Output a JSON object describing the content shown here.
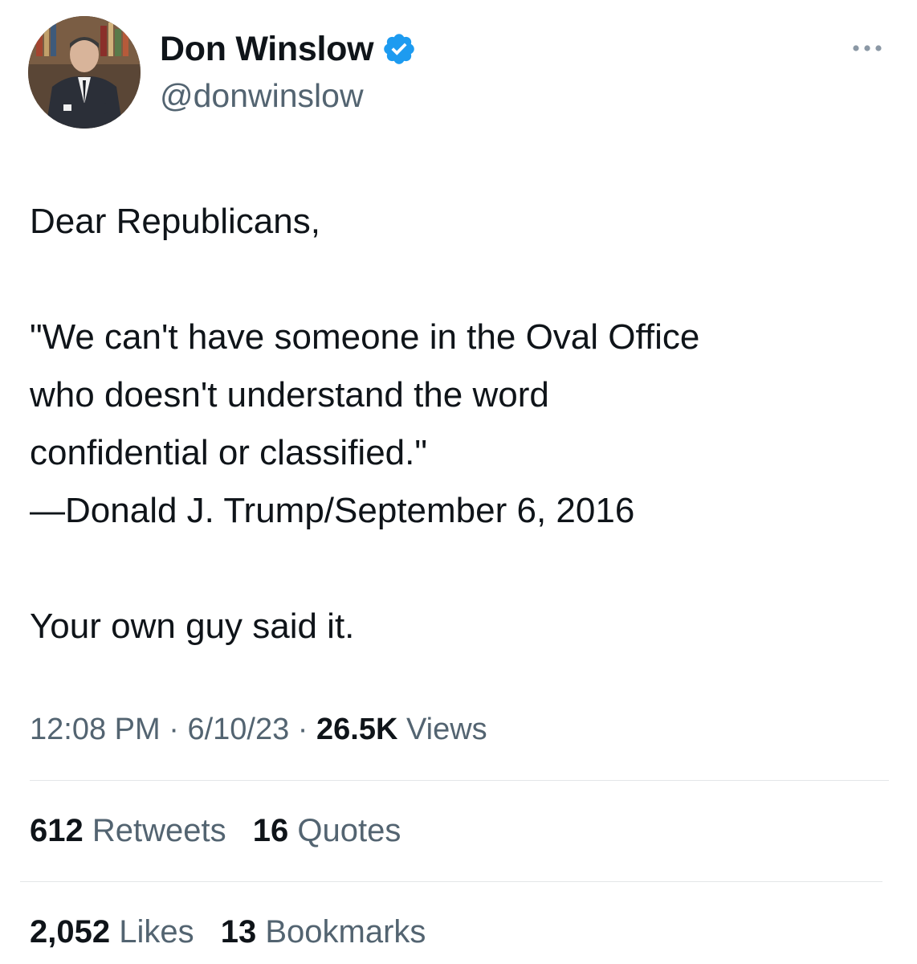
{
  "author": {
    "display_name": "Don Winslow",
    "handle": "@donwinslow",
    "verified": true,
    "verified_color": "#1d9bf0"
  },
  "tweet": {
    "greeting": "Dear Republicans,",
    "quote_lines": [
      "\"We can't have someone in the Oval Office",
      "who doesn't understand the word",
      "confidential or classified.\"",
      "—Donald J. Trump/September 6, 2016"
    ],
    "closing": "Your own guy said it."
  },
  "meta": {
    "time": "12:08 PM",
    "date": "6/10/23",
    "views_count": "26.5K",
    "views_label": "Views",
    "separator": "·"
  },
  "stats": {
    "retweets_count": "612",
    "retweets_label": "Retweets",
    "quotes_count": "16",
    "quotes_label": "Quotes",
    "likes_count": "2,052",
    "likes_label": "Likes",
    "bookmarks_count": "13",
    "bookmarks_label": "Bookmarks"
  },
  "icons": {
    "more": "more-horizontal-icon",
    "verified": "verified-badge-icon"
  },
  "colors": {
    "text_primary": "#0f1419",
    "text_secondary": "#536471",
    "divider": "#e3e6e8"
  }
}
